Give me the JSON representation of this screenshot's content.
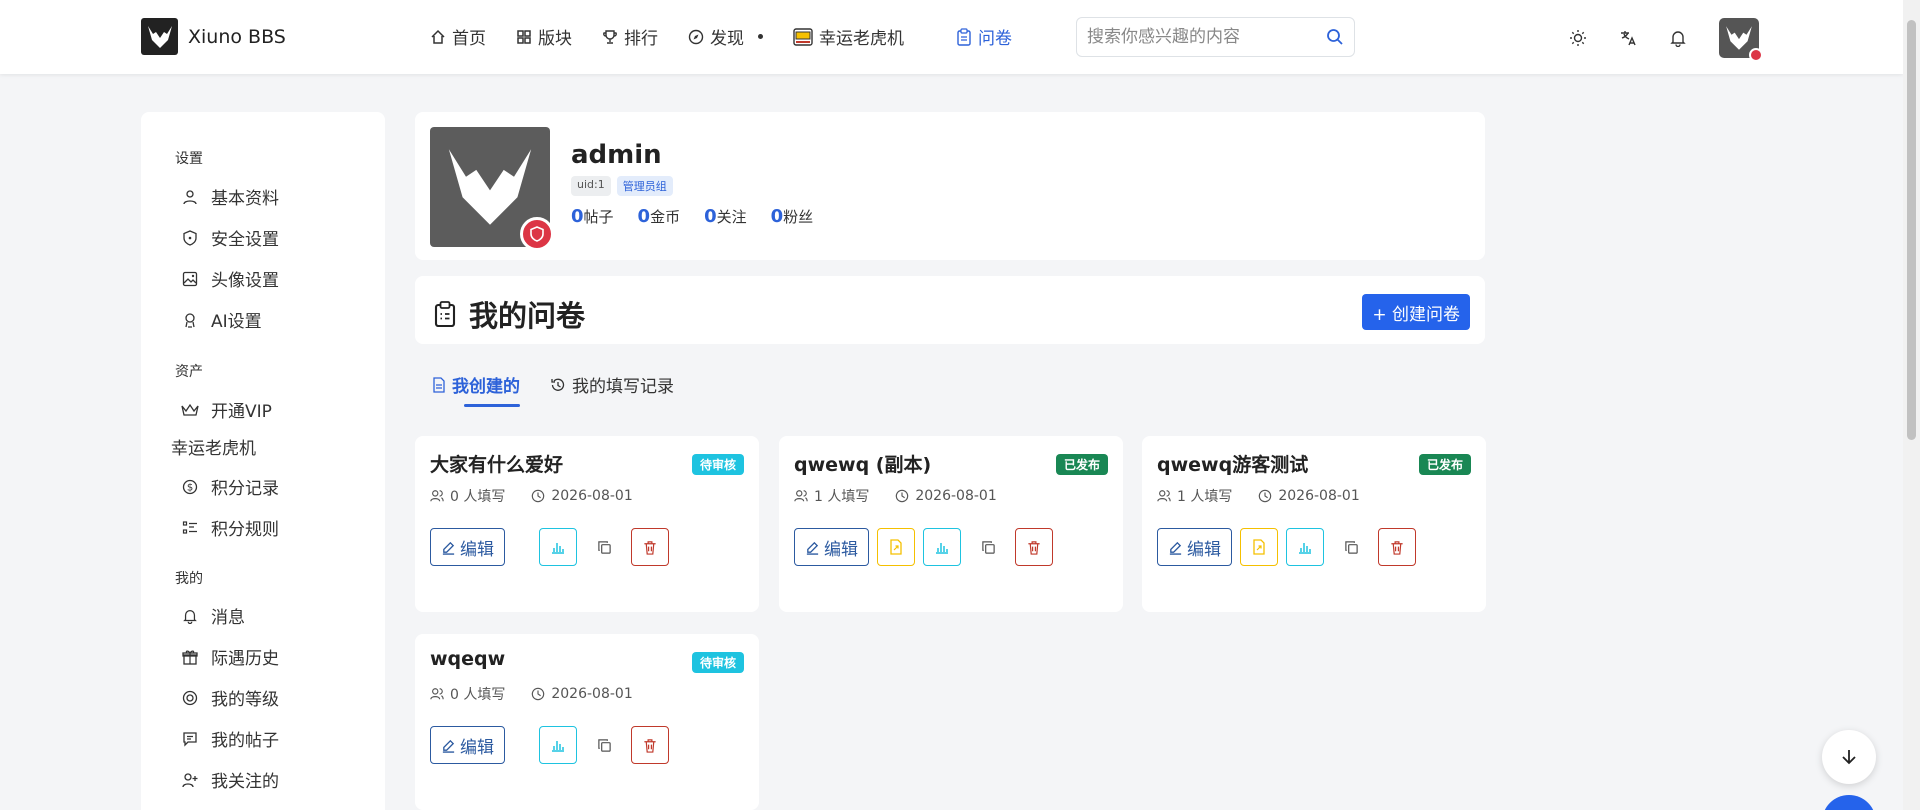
{
  "brand": {
    "name": "Xiuno BBS"
  },
  "nav": {
    "items": [
      {
        "label": "首页",
        "icon": "home-icon"
      },
      {
        "label": "版块",
        "icon": "grid-icon"
      },
      {
        "label": "排行",
        "icon": "trophy-icon"
      },
      {
        "label": "发现",
        "icon": "compass-icon"
      },
      {
        "label": "幸运老虎机",
        "icon": "slot-machine-icon"
      },
      {
        "label": "问卷",
        "icon": "clipboard-icon",
        "active": true
      }
    ]
  },
  "search": {
    "placeholder": "搜索你感兴趣的内容"
  },
  "sidebar": {
    "groups": [
      {
        "title": "设置",
        "items": [
          "基本资料",
          "安全设置",
          "头像设置",
          "AI设置"
        ]
      },
      {
        "title": "资产",
        "items": [
          "开通VIP"
        ]
      },
      {
        "title": "幸运老虎机",
        "items": [
          "积分记录",
          "积分规则"
        ]
      },
      {
        "title": "我的",
        "items": [
          "消息",
          "际遇历史",
          "我的等级",
          "我的帖子",
          "我关注的"
        ]
      }
    ]
  },
  "profile": {
    "name": "admin",
    "uid_tag": "uid:1",
    "group_tag": "管理员组",
    "stats": [
      {
        "value": "0",
        "label": "帖子"
      },
      {
        "value": "0",
        "label": "金币"
      },
      {
        "value": "0",
        "label": "关注"
      },
      {
        "value": "0",
        "label": "粉丝"
      }
    ]
  },
  "surveys": {
    "title": "我的问卷",
    "create_label": "+ 创建问卷",
    "tabs": [
      {
        "label": "我创建的",
        "active": true
      },
      {
        "label": "我的填写记录",
        "active": false
      }
    ],
    "edit_label": "编辑",
    "cards": [
      {
        "title": "大家有什么爱好",
        "status": "待审核",
        "fills": "0 人填写",
        "date": "2026-08-01"
      },
      {
        "title": "qwewq (副本)",
        "status": "已发布",
        "fills": "1 人填写",
        "date": "2026-08-01"
      },
      {
        "title": "qwewq游客测试",
        "status": "已发布",
        "fills": "1 人填写",
        "date": "2026-08-01"
      },
      {
        "title": "wqeqw",
        "status": "待审核",
        "fills": "0 人填写",
        "date": "2026-08-01"
      }
    ]
  },
  "colors": {
    "primary": "#2563eb",
    "pending": "#1ec3e0",
    "published": "#198754",
    "danger": "#dc3545"
  }
}
